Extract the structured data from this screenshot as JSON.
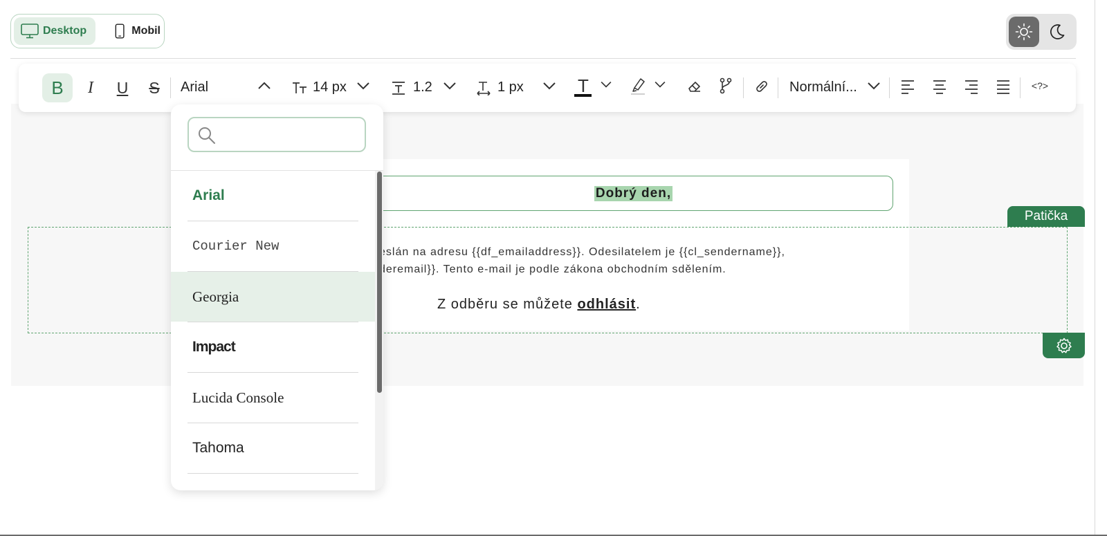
{
  "device_toggle": {
    "desktop": "Desktop",
    "mobile": "Mobil"
  },
  "toolbar": {
    "bold": "B",
    "italic": "I",
    "underline": "U",
    "strike": "S",
    "font_family": "Arial",
    "font_size": "14 px",
    "line_height": "1.2",
    "letter_spacing": "1 px",
    "text_color_glyph": "T",
    "block_style": "Normální...",
    "code_icon": "<?>"
  },
  "font_dropdown": {
    "search_placeholder": "",
    "selected": "Arial",
    "hovered": "Georgia",
    "items": [
      "Arial",
      "Courier New",
      "Georgia",
      "Impact",
      "Lucida Console",
      "Tahoma"
    ]
  },
  "email": {
    "heading": "Dobrý den,",
    "footer_tag": "Patička",
    "footer_line1": "eslán na adresu {{df_emailaddress}}. Odesilatelem je {{cl_sendername}},",
    "footer_line2": "deremail}}. Tento e-mail je podle zákona obchodním sdělením.",
    "unsubscribe_prefix": "Z odběru se můžete ",
    "unsubscribe_link": "odhlásit",
    "unsubscribe_suffix": "."
  },
  "colors": {
    "accent": "#2e7d4f",
    "accent_light": "#e3efe6",
    "highlight": "#a8d5ae"
  }
}
